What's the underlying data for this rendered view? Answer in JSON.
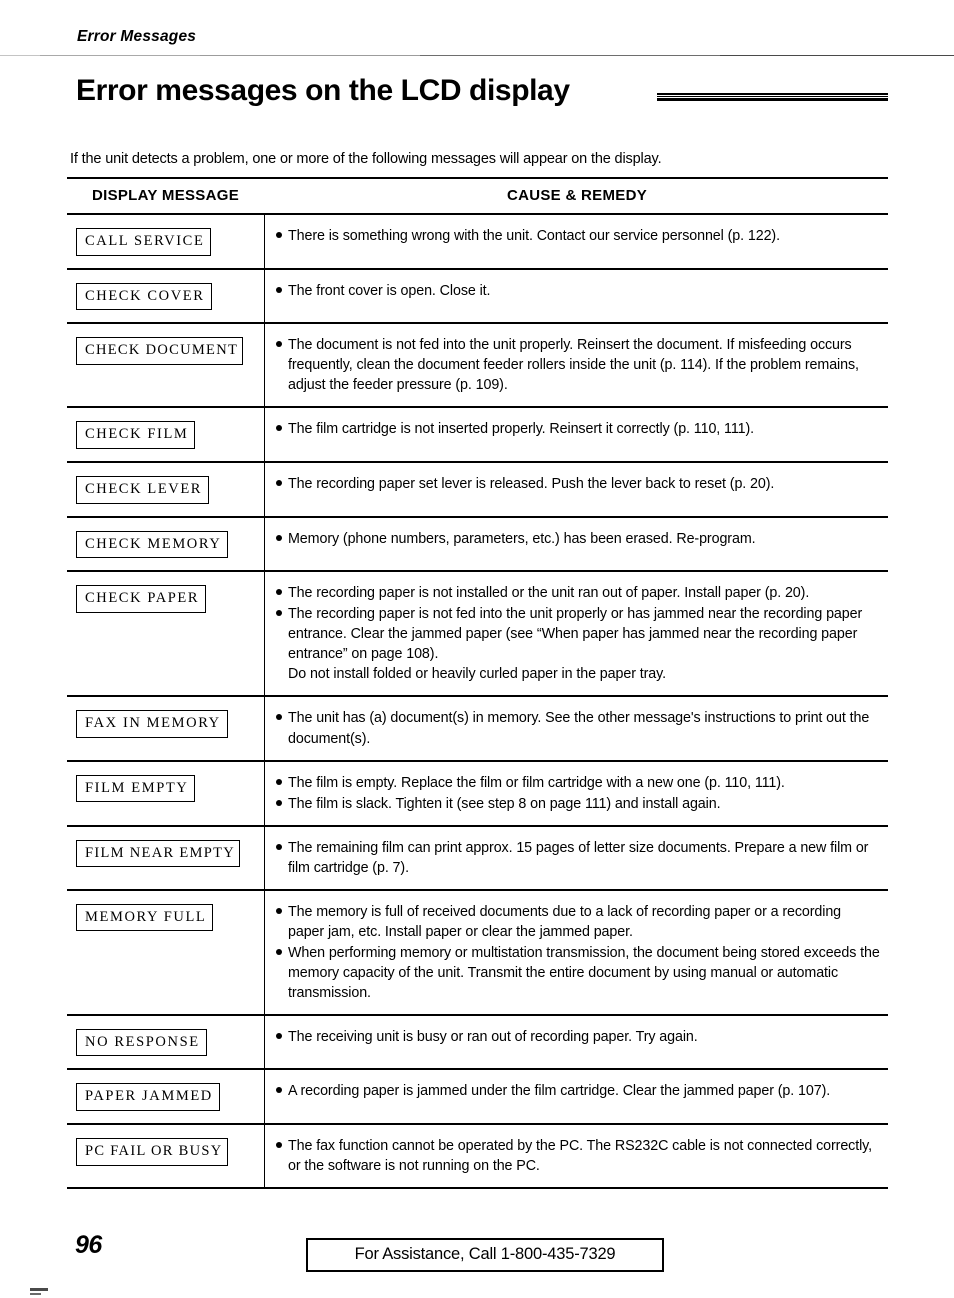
{
  "running_head": "Error Messages",
  "page_title": "Error messages on the LCD display",
  "intro": "If the unit detects a problem, one or more of the following messages will appear on the display.",
  "table": {
    "headers": {
      "display_message": "DISPLAY MESSAGE",
      "cause_remedy": "CAUSE & REMEDY"
    },
    "rows": [
      {
        "message": "CALL SERVICE",
        "causes": [
          [
            "There is something wrong with the unit. Contact our service personnel (p. 122)."
          ]
        ]
      },
      {
        "message": "CHECK COVER",
        "causes": [
          [
            "The front cover is open. Close it."
          ]
        ]
      },
      {
        "message": "CHECK DOCUMENT",
        "causes": [
          [
            "The document is not fed into the unit properly. Reinsert the document. If misfeeding occurs frequently, clean the document feeder rollers inside the unit (p. 114). If the problem remains, adjust the feeder pressure (p. 109)."
          ]
        ]
      },
      {
        "message": "CHECK FILM",
        "causes": [
          [
            "The film cartridge is not inserted properly. Reinsert it correctly (p. 110, 111)."
          ]
        ]
      },
      {
        "message": "CHECK LEVER",
        "causes": [
          [
            "The recording paper set lever is released. Push the lever back to reset (p. 20)."
          ]
        ]
      },
      {
        "message": "CHECK MEMORY",
        "causes": [
          [
            "Memory (phone numbers, parameters, etc.) has been erased. Re-program."
          ]
        ]
      },
      {
        "message": "CHECK PAPER",
        "causes": [
          [
            "The recording paper is not installed or the unit ran out of paper. Install paper (p. 20)."
          ],
          [
            "The recording paper is not fed into the unit properly or has jammed near the recording paper entrance. Clear the jammed paper (see “When paper has jammed near the recording paper entrance” on page 108).",
            "Do not install folded or heavily curled paper in the paper tray."
          ]
        ]
      },
      {
        "message": "FAX IN MEMORY",
        "causes": [
          [
            "The unit has (a) document(s) in memory. See the other message's instructions to print out the document(s)."
          ]
        ]
      },
      {
        "message": "FILM EMPTY",
        "causes": [
          [
            "The film is empty. Replace the film or film cartridge with a new one (p. 110, 111)."
          ],
          [
            "The film is slack. Tighten it (see step 8 on page 111) and install again."
          ]
        ]
      },
      {
        "message": "FILM NEAR EMPTY",
        "causes": [
          [
            "The remaining film can print approx. 15 pages of letter size documents. Prepare a new film or film cartridge (p. 7)."
          ]
        ]
      },
      {
        "message": "MEMORY FULL",
        "causes": [
          [
            "The memory is full of received documents due to a lack of recording paper or a recording paper jam, etc. Install paper or clear the jammed paper."
          ],
          [
            "When performing memory or multistation transmission, the document being stored exceeds the memory capacity of the unit. Transmit the entire document by using manual or automatic transmission."
          ]
        ]
      },
      {
        "message": "NO RESPONSE",
        "causes": [
          [
            "The receiving unit is busy or ran out of recording paper. Try again."
          ]
        ]
      },
      {
        "message": "PAPER JAMMED",
        "causes": [
          [
            "A recording paper is jammed under the film cartridge. Clear the jammed paper (p. 107)."
          ]
        ]
      },
      {
        "message": "PC FAIL OR BUSY",
        "causes": [
          [
            "The fax function cannot be operated by the PC. The RS232C cable is not connected correctly, or the software is not running on the PC."
          ]
        ]
      }
    ]
  },
  "footer": {
    "page_number": "96",
    "assistance": "For Assistance, Call 1-800-435-7329"
  }
}
